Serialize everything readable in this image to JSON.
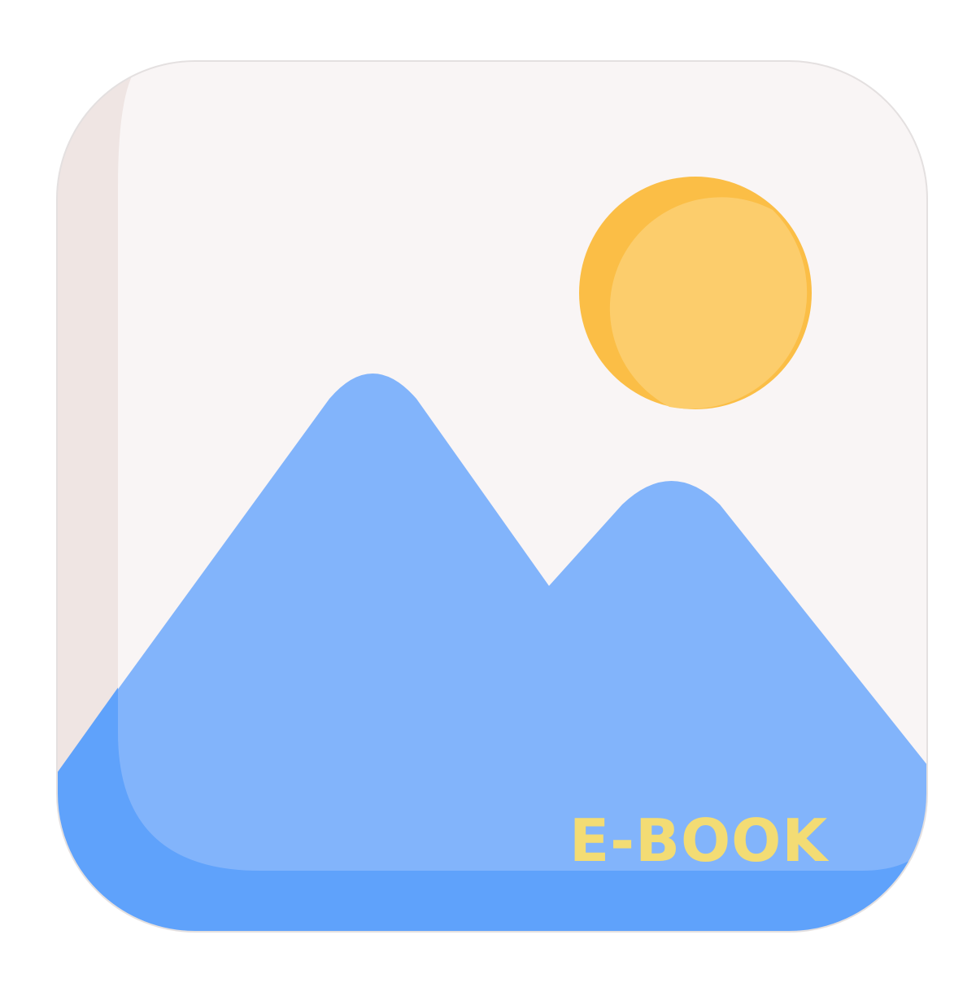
{
  "app_icon": {
    "label": "E-BOOK",
    "depicts": "image-landscape-icon"
  },
  "colors": {
    "page_background": "#ffffff",
    "card_background": "#f9f5f5",
    "card_border": "#e4e0e0",
    "card_side_band": "#efe5e3",
    "mountain_light": "#82b4fb",
    "mountain_dark": "#5fa2fb",
    "sun_dark": "#fbbe46",
    "sun_light": "#fccd6c",
    "label": "#f3dc74"
  }
}
